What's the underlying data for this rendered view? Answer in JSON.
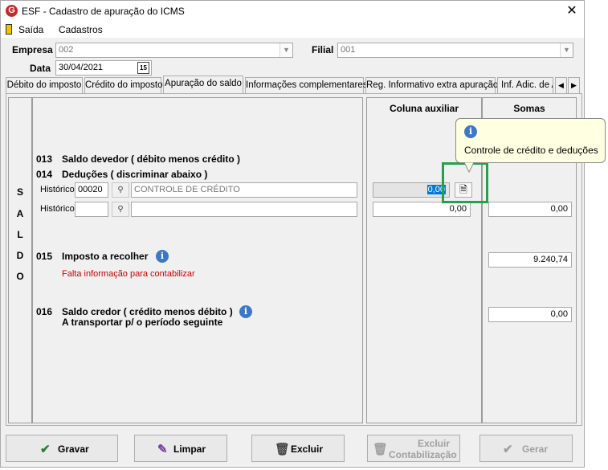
{
  "window": {
    "title": "ESF - Cadastro de apuração do ICMS",
    "app_icon": "G",
    "close_glyph": "✕"
  },
  "menu": {
    "items": [
      "Saída",
      "Cadastros"
    ]
  },
  "header": {
    "empresa_label": "Empresa",
    "empresa_value": "002",
    "filial_label": "Filial",
    "filial_value": "001",
    "data_label": "Data",
    "data_value": "30/04/2021",
    "calendar_glyph": "15"
  },
  "tabs": [
    "Débito do imposto",
    "Crédito do imposto",
    "Apuração do saldo",
    "Informações complementares",
    "Reg. Informativo extra apuração",
    "Inf. Adic. de A"
  ],
  "tab_arrows": {
    "left": "◀",
    "right": "▶"
  },
  "active_tab": 2,
  "saldo_letters": [
    "S",
    "A",
    "L",
    "D",
    "O"
  ],
  "columns": {
    "aux": "Coluna auxiliar",
    "somas": "Somas"
  },
  "rows": {
    "r013": {
      "code": "013",
      "label": "Saldo devedor ( débito menos crédito )"
    },
    "r014": {
      "code": "014",
      "label": "Deduções ( discriminar abaixo )"
    },
    "historico_label": "Histórico",
    "hist1": {
      "code": "00020",
      "desc": "CONTROLE DE CRÉDITO",
      "aux_value": "0,00"
    },
    "hist2": {
      "code": "",
      "desc": "",
      "aux_value": "0,00",
      "soma_value": "0,00"
    },
    "r015": {
      "code": "015",
      "label": "Imposto a recolher",
      "soma_value": "9.240,74",
      "warning": "Falta informação para contabilizar"
    },
    "r016": {
      "code": "016",
      "label": "Saldo credor ( crédito menos débito )",
      "label2": "A transportar p/ o período seguinte",
      "soma_value": "0,00"
    }
  },
  "tooltip": {
    "text": "Controle de crédito e deduções",
    "icon": "info-icon"
  },
  "buttons": {
    "gravar": "Gravar",
    "limpar": "Limpar",
    "excluir": "Excluir",
    "excluir_cont_1": "Excluir",
    "excluir_cont_2": "Contabilização",
    "gerar": "Gerar"
  },
  "colors": {
    "warning": "#cc0000",
    "highlight": "#22a24a",
    "tooltip_bg": "#ffffe1",
    "selection": "#0078d7"
  }
}
